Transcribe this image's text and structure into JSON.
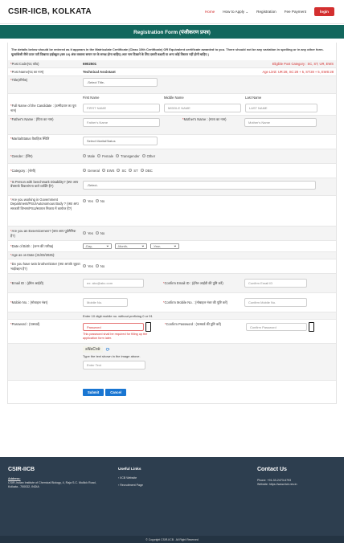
{
  "header": {
    "brand": "CSIR-IICB, KOLKATA",
    "nav": [
      "Home",
      "How to Apply",
      "Registration",
      "Fee Payment"
    ],
    "login": "login",
    "chevron": "⌄"
  },
  "banner": {
    "title": "Registration Form (पंजीकरण प्रपत्र)"
  },
  "notice": "The details below should be entered as it appears in the Matriculate Certificate (Class 10th Certificate) OR Equivalent certificate awarded to you. There should not be any variation in spelling or in any other form. मूल्यांकेसी जैसे ऊपर पाएँ दिखाया हाईस्कूल (वष्ठ 10) अंक वक्तव्य समान पर के समक्ष होना चाहिए| अतः नाम दिखाने के लिए दसवीं कक्षाएँ या अन्य कोई विस्तार नहीं होनी चाहिए |",
  "form": {
    "post_code_label": "Post Code(पद कोड)",
    "post_code_value": "6902501",
    "eligible": "Eligible Post Category : SC, ST, UR, EWS",
    "post_name_label": "Post Name(पद का नाम)",
    "post_name_value": "Technical Assistant",
    "age_limit": "Age Limit: UR:28, SC:28 + 5, ST:28 + 5, EWS:28",
    "title_label": "Title(शीर्षक)",
    "title_value": "-Select Title-",
    "col_first": "First Name",
    "col_middle": "Middle Name",
    "col_last": "Last Name",
    "full_name_label": "Full Name of the Candidate : (उम्मीदवार का पूरा नाम)",
    "first_ph": "FIRST NAME",
    "middle_ph": "MIDDLE NAME",
    "last_ph": "LAST NAME",
    "father_label": "Father's Name : (पिता का नाम)",
    "father_ph": "Father's Name",
    "mother_label": "Mother's Name : (माता का नाम)",
    "mother_ph": "Mother's Name",
    "marital_label": "MaritalStatus वैवाहिक स्थिति",
    "marital_value": "Select MaritalStatus",
    "gender_label": "Gender : (लिंग)",
    "gender_opts": [
      "Male",
      "Female",
      "Transgender",
      "Other"
    ],
    "category_label": "Category : (श्रेणी)",
    "category_opts": [
      "General",
      "EWS",
      "SC",
      "ST",
      "OBC"
    ],
    "pwbd_label": "Is Person with benchmark Disability? (क्या आप बेंचमार्क विकलांगता वाले व्यक्ति हैं?)",
    "pwbd_value": "-Select-",
    "govt_label": "Are you working in Government Department/PSU/Autonomous Body ? (क्या आप सरकारी विभाग/PSU/स्वायत्त निकाय में कार्यरत हैं?)",
    "yes": "Yes",
    "no": "No",
    "exserv_label": "Are you an Exservicemen? (क्या आप पूर्वसैनिक हैं?)",
    "dob_label": "Date of Birth : (जन्म की तारीख)",
    "day": "-Day-",
    "month": "-Month-",
    "year": "-Year-",
    "age_label": "Age as on Date (31/03/2025):",
    "twin_label": "Do you have twin brother/sister (क्या आपके जुड़वा भाई/बहन हैं?)",
    "email_label": "Email ID : (ईमेल आईडी)",
    "email_ph": "ex: abc@abc.com",
    "confirm_email_label": "Confirm Email ID : (ईमेल आईडी की पुष्टि करें)",
    "confirm_email_ph": "Confirm Email ID",
    "mobile_label": "Mobile No. : (मोबाइल नंबर)",
    "mobile_ph": "Mobile No.",
    "confirm_mobile_label": "Confirm Mobile No. : (मोबाइल नंबर की पुष्टि करें)",
    "confirm_mobile_ph": "Confirm Mobile No.",
    "mobile_hint": "Enter 10 digit mobile no. without prefixing 0 or 91",
    "password_label": "Password : (पासवर्ड)",
    "password_ph": "Password",
    "password_err": "This password shall be required for filling up the application form later.",
    "confirm_password_label": "Confirm Password : (पासवर्ड की पुष्टि करें)",
    "confirm_password_ph": "Confirm Password",
    "captcha": "sNeCnk",
    "captcha_hint": "Type the text shown in the image above.",
    "captcha_ph": "Enter Text",
    "submit": "Submit",
    "cancel": "Cancel"
  },
  "footer": {
    "org": "CSIR-IICB",
    "address_title": "Address:",
    "address": "CSIR-Indian Institute of Chemical Biology, 4, Raja S.C. Mullick Road, Kolkata - 700032, INDIA",
    "links_title": "Useful Links",
    "links": [
      "IICB Website",
      "Recruitment Page"
    ],
    "contact_title": "Contact Us",
    "phone": "Phone: +91-33-2473-6793",
    "website": "Website: https://www.iicb.res.in",
    "copyright": "© Copyright CSIR-IICB . All Right Reserved"
  },
  "colors": {
    "banner": "#12675d",
    "accent": "#d32f2f",
    "footer": "#2d3e4f",
    "button": "#1976d2"
  }
}
